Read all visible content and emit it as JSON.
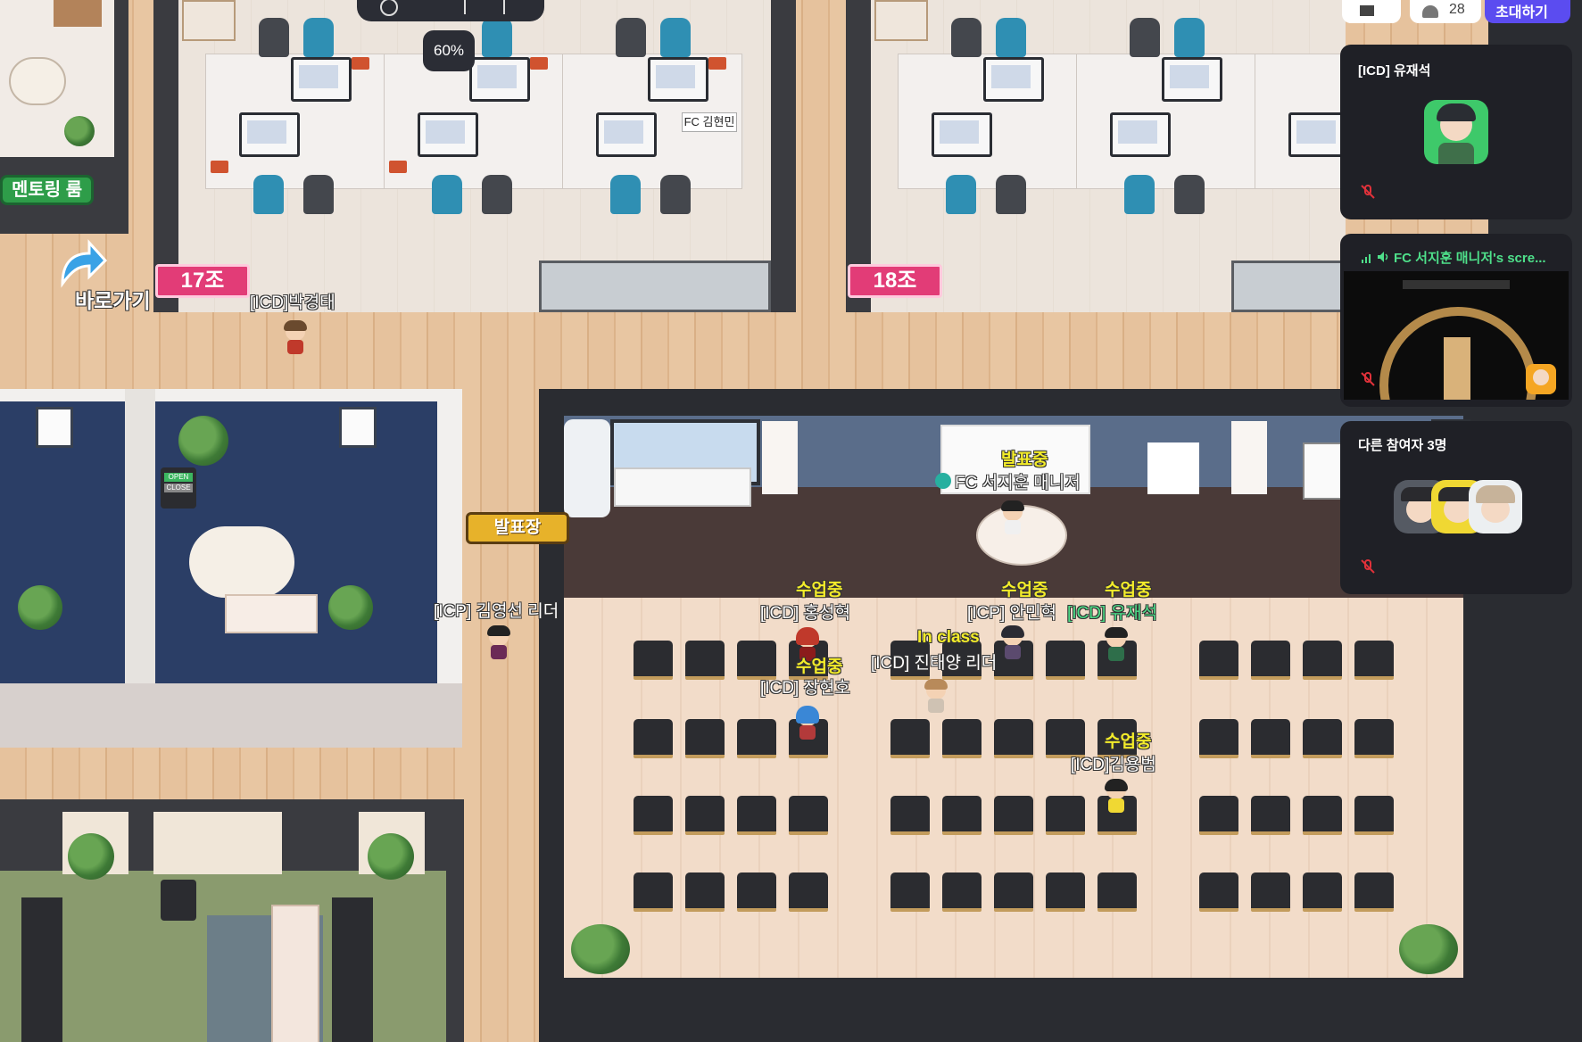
{
  "top_bar": {
    "zoom": "60%",
    "participant_count": "28",
    "invite_label": "초대하기"
  },
  "map": {
    "room_labels": {
      "mentoring_room": "멘토링 룸",
      "shortcut": "바로가기",
      "group_17": "17조",
      "group_18": "18조",
      "presentation_hall": "발표장"
    },
    "desk_nameplate": "FC 김현민",
    "presenting_status": "발표중",
    "presenter_name": "FC 서지훈 매니저",
    "door_sign": {
      "open": "OPEN",
      "close": "CLOSE"
    },
    "characters": [
      {
        "name": "[ICD]박경태",
        "status": ""
      },
      {
        "name": "[ICP] 김영선 리더",
        "status": ""
      },
      {
        "name": "[ICD] 홍성혁",
        "status": "수업중"
      },
      {
        "name": "[ICD] 장현호",
        "status": "수업중"
      },
      {
        "name": "[ICD] 진태양 리더",
        "status": "In class"
      },
      {
        "name": "[ICP] 안민혁",
        "status": "수업중"
      },
      {
        "name": "[ICD] 유재석",
        "status": "수업중"
      },
      {
        "name": "[ICD]김용범",
        "status": "수업중"
      }
    ]
  },
  "side_panel": {
    "self_card": {
      "title": "[ICD] 유재석"
    },
    "screen_share_card": {
      "title": "FC 서지훈 매니저's scre..."
    },
    "others_card": {
      "title": "다른 참여자 3명"
    }
  },
  "colors": {
    "accent": "#5b4cf0",
    "status_yellow": "#f3ec2a",
    "speaking_green": "#4ee08a"
  }
}
